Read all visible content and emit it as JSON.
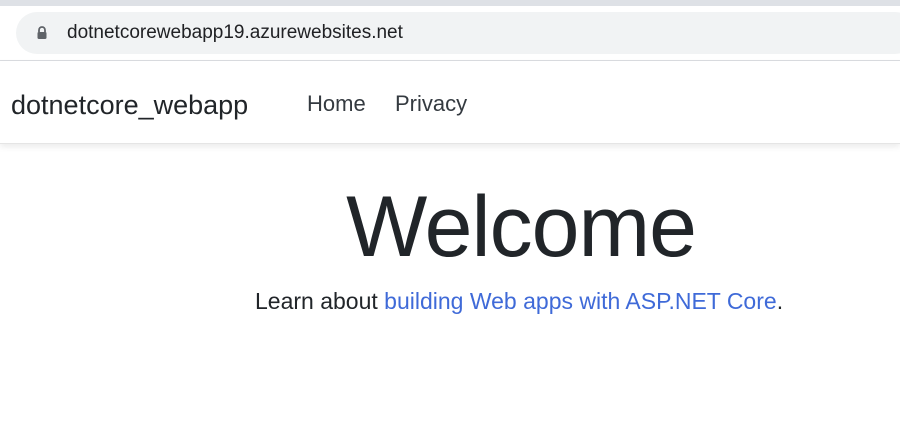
{
  "browser": {
    "url": "dotnetcorewebapp19.azurewebsites.net",
    "lock_icon": "lock-icon"
  },
  "navbar": {
    "brand": "dotnetcore_webapp",
    "links": [
      {
        "label": "Home"
      },
      {
        "label": "Privacy"
      }
    ]
  },
  "main": {
    "title": "Welcome",
    "learn_prefix": "Learn about ",
    "learn_link_text": "building Web apps with ASP.NET Core",
    "learn_suffix": "."
  },
  "colors": {
    "link": "#3f6ad8",
    "text": "#212529",
    "address_bar_bg": "#f1f3f4"
  }
}
